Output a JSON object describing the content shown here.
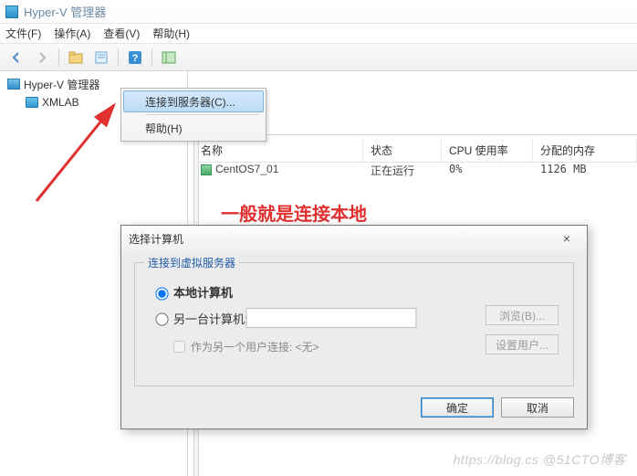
{
  "title": "Hyper-V 管理器",
  "menu": {
    "file": "文件(F)",
    "actions": "操作(A)",
    "view": "查看(V)",
    "help": "帮助(H)"
  },
  "tree": {
    "root": "Hyper-V 管理器",
    "host": "XMLAB"
  },
  "context_menu": {
    "connect": "连接到服务器(C)...",
    "help": "帮助(H)"
  },
  "columns": {
    "name": "名称",
    "state": "状态",
    "cpu": "CPU 使用率",
    "mem": "分配的内存"
  },
  "vm": {
    "name": "CentOS7_01",
    "state": "正在运行",
    "cpu": "0%",
    "mem": "1126 MB"
  },
  "annotation": "一般就是连接本地",
  "dialog": {
    "title": "选择计算机",
    "group": "连接到虚拟服务器",
    "radio_local": "本地计算机",
    "radio_remote": "另一台计算机:",
    "browse": "浏览(B)...",
    "checkbox": "作为另一个用户连接: <无>",
    "set_user": "设置用户...",
    "ok": "确定",
    "cancel": "取消"
  },
  "watermark": "https://blog.cs @51CTO博客"
}
